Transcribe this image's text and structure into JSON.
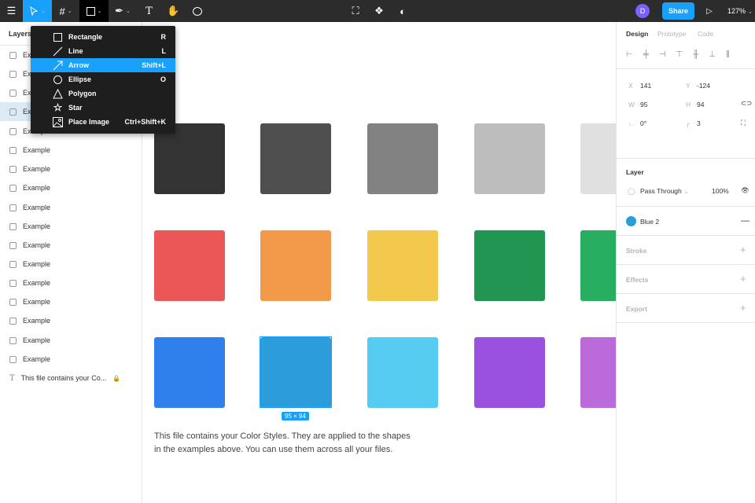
{
  "toolbar": {
    "zoom": "127%",
    "share": "Share",
    "avatar": "D"
  },
  "menu": {
    "items": [
      {
        "label": "Rectangle",
        "shortcut": "R",
        "icon": "rectangle-icon"
      },
      {
        "label": "Line",
        "shortcut": "L",
        "icon": "line-icon"
      },
      {
        "label": "Arrow",
        "shortcut": "Shift+L",
        "icon": "arrow-icon",
        "highlighted": true
      },
      {
        "label": "Ellipse",
        "shortcut": "O",
        "icon": "ellipse-icon"
      },
      {
        "label": "Polygon",
        "shortcut": "",
        "icon": "polygon-icon"
      },
      {
        "label": "Star",
        "shortcut": "",
        "icon": "star-icon"
      },
      {
        "label": "Place Image",
        "shortcut": "Ctrl+Shift+K",
        "icon": "image-icon"
      }
    ]
  },
  "layers": {
    "title": "Layers",
    "items": [
      "Example",
      "Example",
      "Example",
      "Example",
      "Example",
      "Example",
      "Example",
      "Example",
      "Example",
      "Example",
      "Example",
      "Example",
      "Example",
      "Example",
      "Example",
      "Example",
      "Example"
    ],
    "selected_index": 3,
    "text_item": "This file contains your Co..."
  },
  "canvas": {
    "swatches": [
      [
        "#333333",
        "#4f4f4f",
        "#828282",
        "#bdbdbd",
        "#e0e0e0"
      ],
      [
        "#eb5757",
        "#f2994a",
        "#f2c94c",
        "#219653",
        "#27ae60"
      ],
      [
        "#2f80ed",
        "#2d9cdb",
        "#56ccf2",
        "#9b51e0",
        "#bb6bd9"
      ]
    ],
    "size_label": "95 × 94",
    "description_line1": "This file contains your Color Styles. They are applied to the shapes",
    "description_line2": "in the examples above. You can use them across all your files."
  },
  "design": {
    "tabs": [
      "Design",
      "Prototype",
      "Code"
    ],
    "x_label": "X",
    "x": "141",
    "y_label": "Y",
    "y": "-124",
    "w_label": "W",
    "w": "95",
    "h_label": "H",
    "h": "94",
    "rotation": "0°",
    "radius": "3",
    "layer_title": "Layer",
    "blend": "Pass Through",
    "opacity": "100%",
    "fill_name": "Blue 2",
    "fill_color": "#2d9cdb",
    "stroke": "Stroke",
    "effects": "Effects",
    "export": "Export"
  },
  "colors": {
    "accent": "#18a0fb",
    "toolbar": "#2c2c2c",
    "avatar": "#7b61ff"
  }
}
